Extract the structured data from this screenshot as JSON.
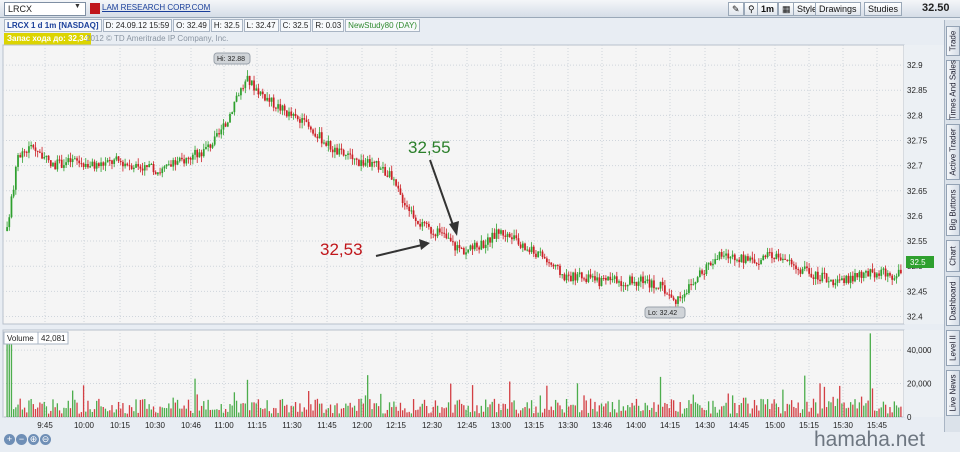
{
  "toolbar": {
    "symbol": "LRCX",
    "company_link": "LAM RESEARCH CORP.COM",
    "timeframe": "1m",
    "style_label": "Style",
    "drawings_label": "Drawings",
    "studies_label": "Studies",
    "last_price": "32.50"
  },
  "infobar": {
    "symbol_desc": "LRCX 1 d 1m [NASDAQ]",
    "date": "D: 24.09.12 15:59",
    "open": "O: 32.49",
    "high": "H: 32.5",
    "low": "L: 32.47",
    "close": "C: 32.5",
    "range": "R: 0.03",
    "study": "NewStudy80 (DAY)"
  },
  "yellow_tag": "Запас хода до: 32,34",
  "copyright": "2012 © TD Ameritrade IP Company, Inc.",
  "sidebar_tabs": [
    "Trade",
    "Times And Sales",
    "Active Trader",
    "Big Buttons",
    "Chart",
    "Dashboard",
    "Level II",
    "Live News"
  ],
  "watermark": "hamaha.net",
  "colors": {
    "up": "#2ea02e",
    "down": "#cc1f25",
    "annotation_high": "#2a7f2a",
    "annotation_low": "#c0161b"
  },
  "chart_data": {
    "type": "candlestick",
    "x_ticks": [
      "9:45",
      "10:00",
      "10:15",
      "10:30",
      "10:46",
      "11:00",
      "11:15",
      "11:30",
      "11:45",
      "12:00",
      "12:15",
      "12:30",
      "12:45",
      "13:00",
      "13:15",
      "13:30",
      "13:46",
      "14:00",
      "14:15",
      "14:30",
      "14:45",
      "15:00",
      "15:15",
      "15:30",
      "15:45"
    ],
    "price_axis": {
      "ticks": [
        "32.4",
        "32.45",
        "32.5",
        "32.55",
        "32.6",
        "32.65",
        "32.7",
        "32.75",
        "32.8",
        "32.85",
        "32.9"
      ],
      "ylim": [
        32.385,
        32.94
      ],
      "current_label": "32.5"
    },
    "price_path": [
      [
        0,
        32.57
      ],
      [
        5,
        32.72
      ],
      [
        12,
        32.74
      ],
      [
        20,
        32.7
      ],
      [
        30,
        32.71
      ],
      [
        40,
        32.7
      ],
      [
        50,
        32.71
      ],
      [
        60,
        32.7
      ],
      [
        70,
        32.69
      ],
      [
        80,
        32.71
      ],
      [
        90,
        32.73
      ],
      [
        95,
        32.75
      ],
      [
        100,
        32.78
      ],
      [
        105,
        32.84
      ],
      [
        110,
        32.87
      ],
      [
        120,
        32.83
      ],
      [
        130,
        32.8
      ],
      [
        140,
        32.77
      ],
      [
        150,
        32.73
      ],
      [
        160,
        32.71
      ],
      [
        170,
        32.7
      ],
      [
        175,
        32.68
      ],
      [
        180,
        32.64
      ],
      [
        185,
        32.61
      ],
      [
        190,
        32.58
      ],
      [
        195,
        32.57
      ],
      [
        200,
        32.56
      ],
      [
        205,
        32.54
      ],
      [
        210,
        32.53
      ],
      [
        215,
        32.54
      ],
      [
        220,
        32.55
      ],
      [
        225,
        32.57
      ],
      [
        230,
        32.56
      ],
      [
        235,
        32.54
      ],
      [
        240,
        32.53
      ],
      [
        245,
        32.52
      ],
      [
        250,
        32.5
      ],
      [
        255,
        32.48
      ],
      [
        260,
        32.48
      ],
      [
        270,
        32.47
      ],
      [
        280,
        32.47
      ],
      [
        290,
        32.47
      ],
      [
        300,
        32.46
      ],
      [
        305,
        32.43
      ],
      [
        310,
        32.45
      ],
      [
        315,
        32.47
      ],
      [
        320,
        32.5
      ],
      [
        325,
        32.52
      ],
      [
        330,
        32.52
      ],
      [
        340,
        32.51
      ],
      [
        350,
        32.52
      ],
      [
        355,
        32.52
      ],
      [
        360,
        32.5
      ],
      [
        365,
        32.49
      ],
      [
        370,
        32.48
      ],
      [
        380,
        32.47
      ],
      [
        390,
        32.48
      ],
      [
        400,
        32.49
      ],
      [
        405,
        32.48
      ],
      [
        410,
        32.5
      ]
    ],
    "volume_axis": {
      "ticks": [
        "0",
        "20,000",
        "40,000"
      ],
      "ylim": [
        0,
        52000
      ]
    },
    "volume_label": "Volume",
    "volume_value": "42,081",
    "annotations": {
      "high_label": "Hi: 32.88",
      "low_label": "Lo: 32.42",
      "arrow_high": "32,55",
      "arrow_low": "32,53"
    }
  }
}
